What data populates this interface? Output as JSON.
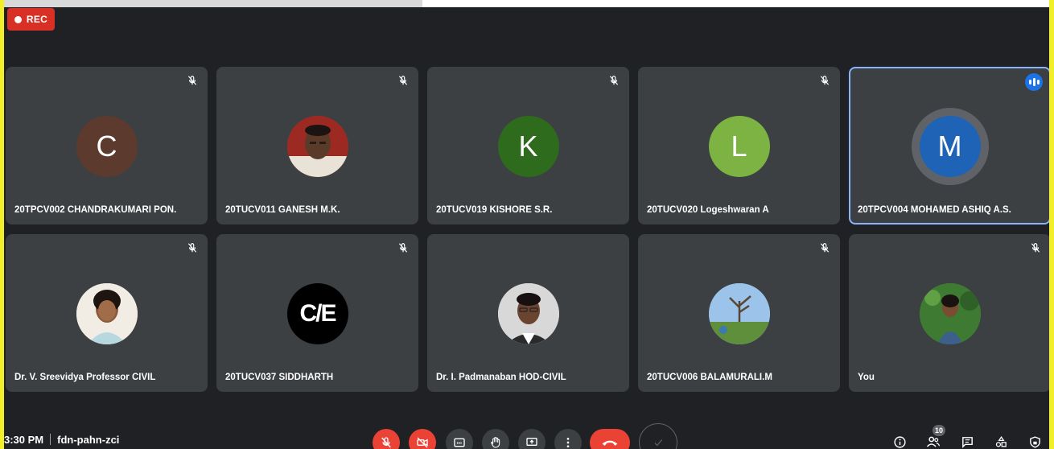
{
  "recording": {
    "label": "REC"
  },
  "participants": [
    {
      "name": "20TPCV002 CHANDRAKUMARI PON.",
      "initial": "C",
      "avatar_color": "#5d3a2e",
      "muted": true
    },
    {
      "name": "20TUCV011 GANESH M.K.",
      "initial": "",
      "photo": true,
      "muted": true
    },
    {
      "name": "20TUCV019 KISHORE S.R.",
      "initial": "K",
      "avatar_color": "#2e6b1d",
      "muted": true
    },
    {
      "name": "20TUCV020 Logeshwaran A",
      "initial": "L",
      "avatar_color": "#7cb342",
      "muted": true
    },
    {
      "name": "20TPCV004 MOHAMED ASHIQ A.S.",
      "initial": "M",
      "avatar_color": "#1e63b5",
      "speaking": true
    },
    {
      "name": "Dr. V. Sreevidya Professor CIVIL",
      "initial": "",
      "photo": true,
      "muted": true
    },
    {
      "name": "20TUCV037 SIDDHARTH",
      "initial": "C/E",
      "photo": true,
      "muted": true
    },
    {
      "name": "Dr. I. Padmanaban HOD-CIVIL",
      "initial": "",
      "photo": true,
      "muted": false
    },
    {
      "name": "20TUCV006 BALAMURALI.M",
      "initial": "",
      "photo": true,
      "muted": true
    },
    {
      "name": "You",
      "initial": "",
      "photo": true,
      "muted": true
    }
  ],
  "meeting": {
    "time": "3:30 PM",
    "code": "fdn-pahn-zci"
  },
  "people_count": "10",
  "colors": {
    "background": "#202124",
    "tile": "#3c4043",
    "accent": "#1a73e8",
    "danger": "#ea4335",
    "frame": "#f1ef2a"
  },
  "controls": [
    "mic-off-icon",
    "camera-off-icon",
    "captions-icon",
    "raise-hand-icon",
    "present-icon",
    "more-options-icon",
    "leave-call-icon",
    "reaction-icon"
  ],
  "right_panel": [
    "info-icon",
    "people-icon",
    "chat-icon",
    "activities-icon",
    "host-controls-icon"
  ]
}
